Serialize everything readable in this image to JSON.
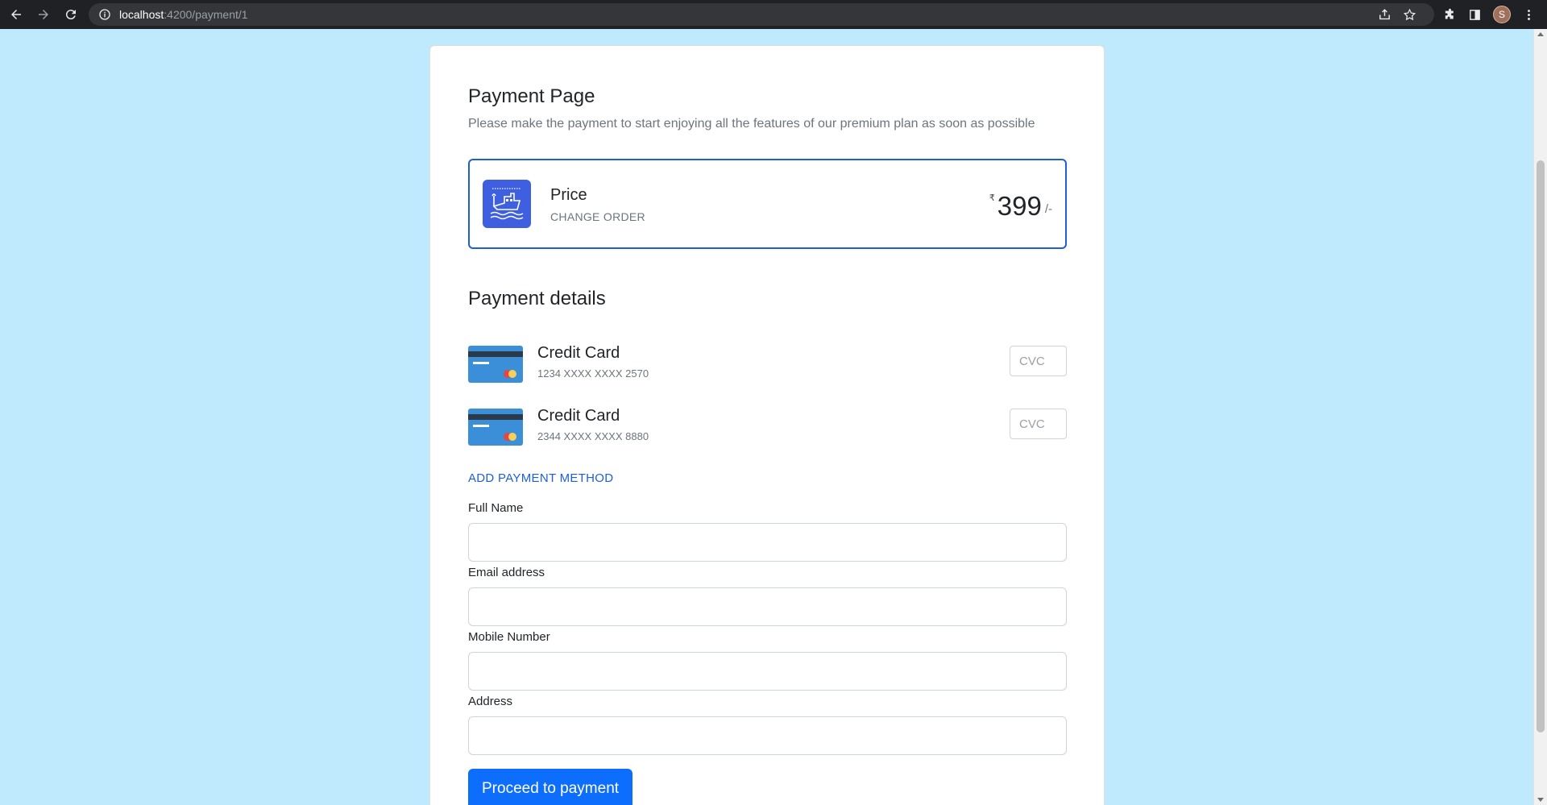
{
  "browser": {
    "url_host": "localhost",
    "url_path": ":4200/payment/1",
    "avatar_initial": "S"
  },
  "page": {
    "title": "Payment Page",
    "subtitle": "Please make the payment to start enjoying all the features of our premium plan as soon as possible"
  },
  "price_box": {
    "label": "Price",
    "change_order": "CHANGE ORDER",
    "currency": "₹",
    "amount": "399",
    "suffix": "/-"
  },
  "payment_details": {
    "title": "Payment details",
    "cards": [
      {
        "name": "Credit Card",
        "number": "1234 XXXX XXXX 2570",
        "cvc_placeholder": "CVC"
      },
      {
        "name": "Credit Card",
        "number": "2344 XXXX XXXX 8880",
        "cvc_placeholder": "CVC"
      }
    ],
    "add_method": "ADD PAYMENT METHOD"
  },
  "form": {
    "full_name_label": "Full Name",
    "email_label": "Email address",
    "mobile_label": "Mobile Number",
    "address_label": "Address",
    "full_name_value": "",
    "email_value": "",
    "mobile_value": "",
    "address_value": ""
  },
  "proceed_label": "Proceed to payment",
  "colors": {
    "background": "#bfe9fc",
    "accent": "#1f5fd6",
    "button": "#0d6efd",
    "ship_tile": "#3d5fe0",
    "card_blue": "#3b8fd9"
  },
  "icons": [
    "back-arrow-icon",
    "forward-arrow-icon",
    "reload-icon",
    "info-icon",
    "share-icon",
    "star-icon",
    "extensions-icon",
    "sidepanel-icon",
    "menu-dots-icon",
    "ship-icon",
    "credit-card-icon"
  ]
}
